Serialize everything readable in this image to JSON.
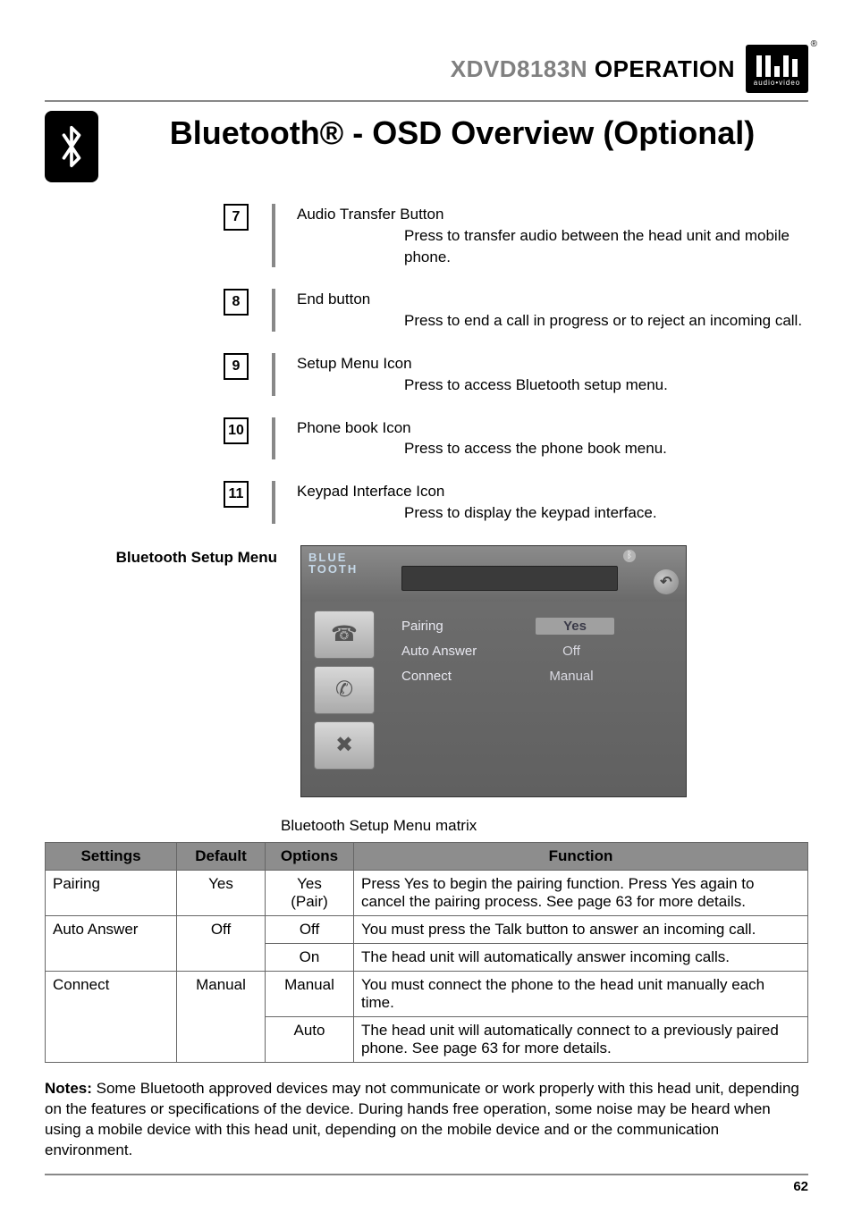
{
  "header": {
    "model": "XDVD8183N",
    "operation": "OPERATION",
    "logo_caption": "audio•video"
  },
  "title": "Bluetooth® - OSD Overview (Optional)",
  "callouts": [
    {
      "num": "7",
      "label": "Audio Transfer Button",
      "desc": "Press to transfer audio between the head unit and mobile phone."
    },
    {
      "num": "8",
      "label": "End button",
      "desc": "Press to end a call in progress or to reject an incoming call."
    },
    {
      "num": "9",
      "label": "Setup Menu Icon",
      "desc": "Press to access Bluetooth setup menu."
    },
    {
      "num": "10",
      "label": "Phone book Icon",
      "desc": "Press to access the phone book menu."
    },
    {
      "num": "11",
      "label": "Keypad Interface Icon",
      "desc": "Press to display the keypad interface."
    }
  ],
  "setup_label": "Bluetooth Setup Menu",
  "screenshot": {
    "brand_top": "BLUE",
    "brand_bot": "TOOTH",
    "rows": [
      {
        "label": "Pairing",
        "value": "Yes",
        "hl": true
      },
      {
        "label": "Auto  Answer",
        "value": "Off",
        "hl": false
      },
      {
        "label": "Connect",
        "value": "Manual",
        "hl": false
      }
    ],
    "side_icons": [
      "☎",
      "✆",
      "✖"
    ]
  },
  "matrix_caption": "Bluetooth Setup Menu matrix",
  "matrix_headers": {
    "settings": "Settings",
    "default": "Default",
    "options": "Options",
    "function": "Function"
  },
  "matrix": [
    {
      "setting": "Pairing",
      "default": "Yes",
      "options": [
        {
          "opt": "Yes (Pair)",
          "func": "Press Yes to begin the pairing function. Press Yes again to cancel the pairing process. See page 63 for more details."
        }
      ]
    },
    {
      "setting": "Auto Answer",
      "default": "Off",
      "options": [
        {
          "opt": "Off",
          "func": "You must press the Talk button to answer an incoming call."
        },
        {
          "opt": "On",
          "func": "The head unit will automatically answer incoming calls."
        }
      ]
    },
    {
      "setting": "Connect",
      "default": "Manual",
      "options": [
        {
          "opt": "Manual",
          "func": "You must connect the phone to the head unit manually each time."
        },
        {
          "opt": "Auto",
          "func": "The head unit will automatically connect to a previously paired phone. See page 63 for more details."
        }
      ]
    }
  ],
  "notes_label": "Notes:",
  "notes": "Some Bluetooth approved devices may not communicate or work properly with this head unit, depending on the features or specifications of the device. During hands free operation, some noise may be heard when using a mobile device with this head unit, depending on the mobile device and or the communication  environment.",
  "page_number": "62"
}
